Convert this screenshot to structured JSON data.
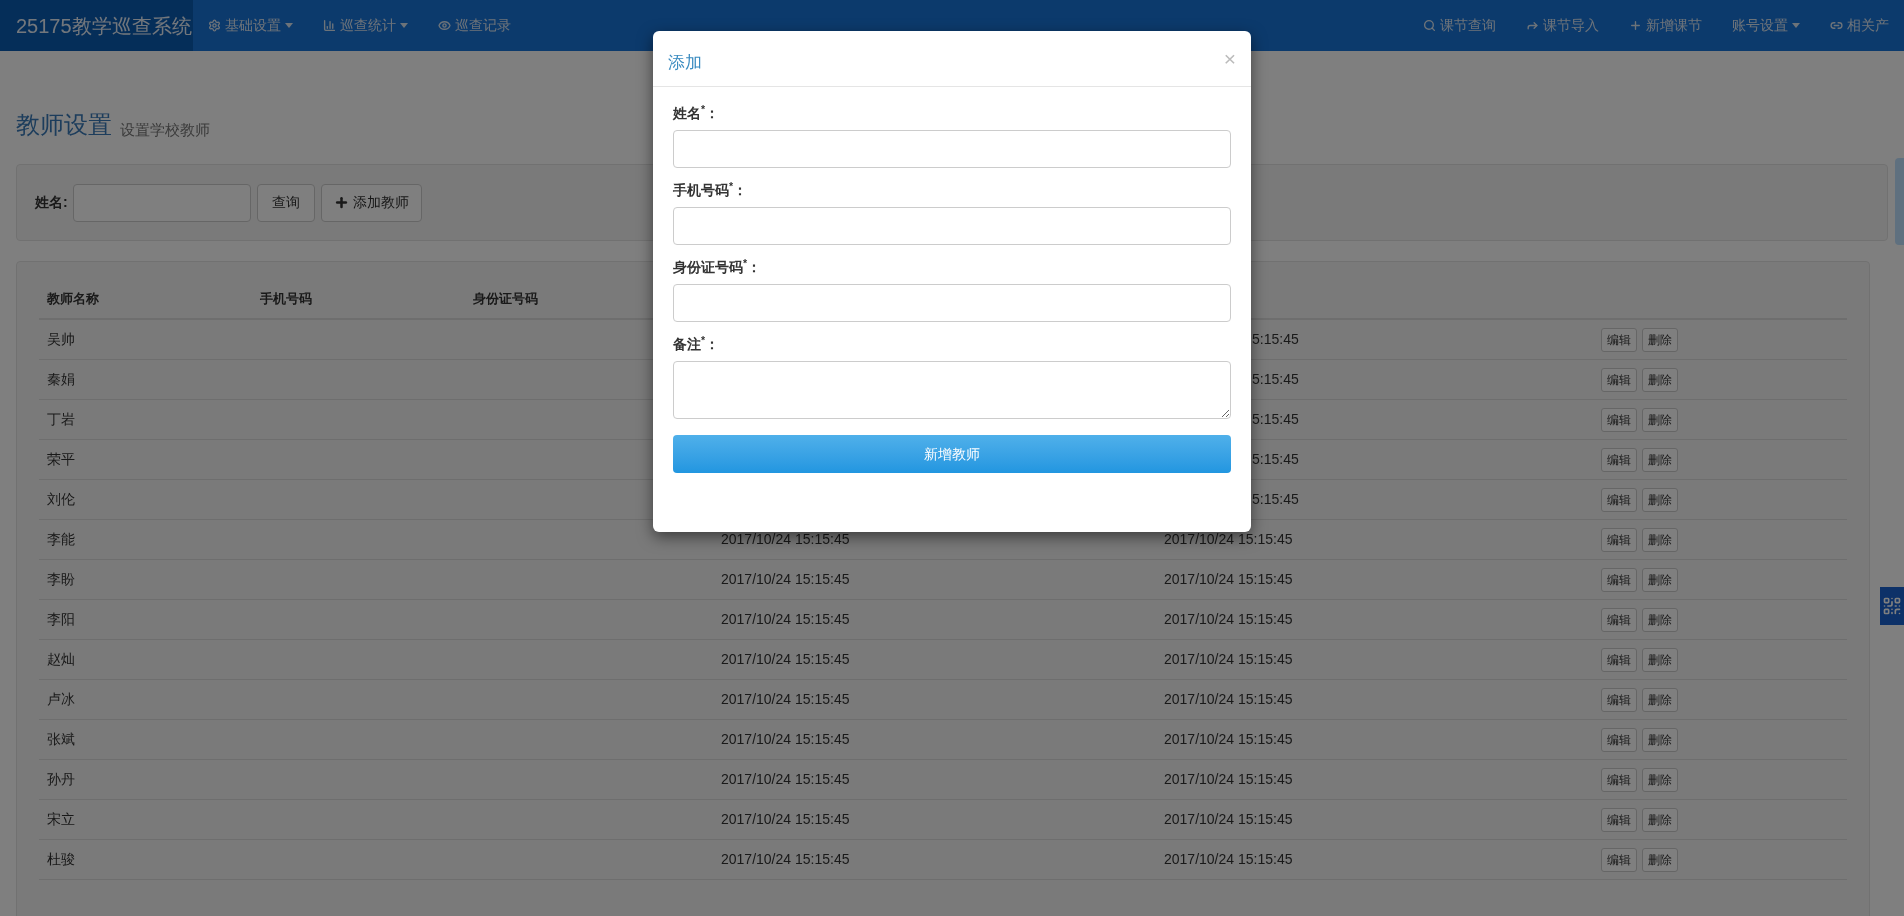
{
  "navbar": {
    "brand": "25175教学巡查系统",
    "left_items": [
      {
        "label": "基础设置",
        "dropdown": true
      },
      {
        "label": "巡查统计",
        "dropdown": true
      },
      {
        "label": "巡查记录",
        "dropdown": false
      }
    ],
    "right_items": [
      {
        "label": "课节查询",
        "dropdown": false
      },
      {
        "label": "课节导入",
        "dropdown": false
      },
      {
        "label": "新增课节",
        "dropdown": false
      },
      {
        "label": "账号设置",
        "dropdown": true
      },
      {
        "label": "相关产",
        "dropdown": false
      }
    ]
  },
  "page_header": {
    "title": "教师设置",
    "subtitle": "设置学校教师"
  },
  "search": {
    "label": "姓名:",
    "query_button": "查询",
    "add_button": "添加教师"
  },
  "table": {
    "columns": [
      "教师名称",
      "手机号码",
      "身份证号码"
    ],
    "rows": [
      {
        "name": "吴帅",
        "time_2": "5:15:45",
        "actions": [
          "编辑",
          "删除"
        ]
      },
      {
        "name": "秦娟",
        "time_2": "5:15:45",
        "actions": [
          "编辑",
          "删除"
        ]
      },
      {
        "name": "丁岩",
        "time_2": "5:15:45",
        "actions": [
          "编辑",
          "删除"
        ]
      },
      {
        "name": "荣平",
        "time_2": "5:15:45",
        "actions": [
          "编辑",
          "删除"
        ]
      },
      {
        "name": "刘伦",
        "time_2": "5:15:45",
        "actions": [
          "编辑",
          "删除"
        ]
      },
      {
        "name": "李能",
        "time_1": "2017/10/24 15:15:45",
        "time_2": "2017/10/24 15:15:45",
        "actions": [
          "编辑",
          "删除"
        ]
      },
      {
        "name": "李盼",
        "time_1": "2017/10/24 15:15:45",
        "time_2": "2017/10/24 15:15:45",
        "actions": [
          "编辑",
          "删除"
        ]
      },
      {
        "name": "李阳",
        "time_1": "2017/10/24 15:15:45",
        "time_2": "2017/10/24 15:15:45",
        "actions": [
          "编辑",
          "删除"
        ]
      },
      {
        "name": "赵灿",
        "time_1": "2017/10/24 15:15:45",
        "time_2": "2017/10/24 15:15:45",
        "actions": [
          "编辑",
          "删除"
        ]
      },
      {
        "name": "卢冰",
        "time_1": "2017/10/24 15:15:45",
        "time_2": "2017/10/24 15:15:45",
        "actions": [
          "编辑",
          "删除"
        ]
      },
      {
        "name": "张斌",
        "time_1": "2017/10/24 15:15:45",
        "time_2": "2017/10/24 15:15:45",
        "actions": [
          "编辑",
          "删除"
        ]
      },
      {
        "name": "孙丹",
        "time_1": "2017/10/24 15:15:45",
        "time_2": "2017/10/24 15:15:45",
        "actions": [
          "编辑",
          "删除"
        ]
      },
      {
        "name": "宋立",
        "time_1": "2017/10/24 15:15:45",
        "time_2": "2017/10/24 15:15:45",
        "actions": [
          "编辑",
          "删除"
        ]
      },
      {
        "name": "杜骏",
        "time_1": "2017/10/24 15:15:45",
        "time_2": "2017/10/24 15:15:45",
        "actions": [
          "编辑",
          "删除"
        ]
      }
    ]
  },
  "modal": {
    "title": "添加",
    "close": "×",
    "fields": [
      {
        "label": "姓名$^{*}$：",
        "kind": "input"
      },
      {
        "label": "手机号码$^{*}$：",
        "kind": "input"
      },
      {
        "label": "身份证号码$^{*}$：",
        "kind": "input"
      },
      {
        "label": "备注$^{*}$：",
        "kind": "textarea"
      }
    ],
    "submit": "新增教师"
  }
}
